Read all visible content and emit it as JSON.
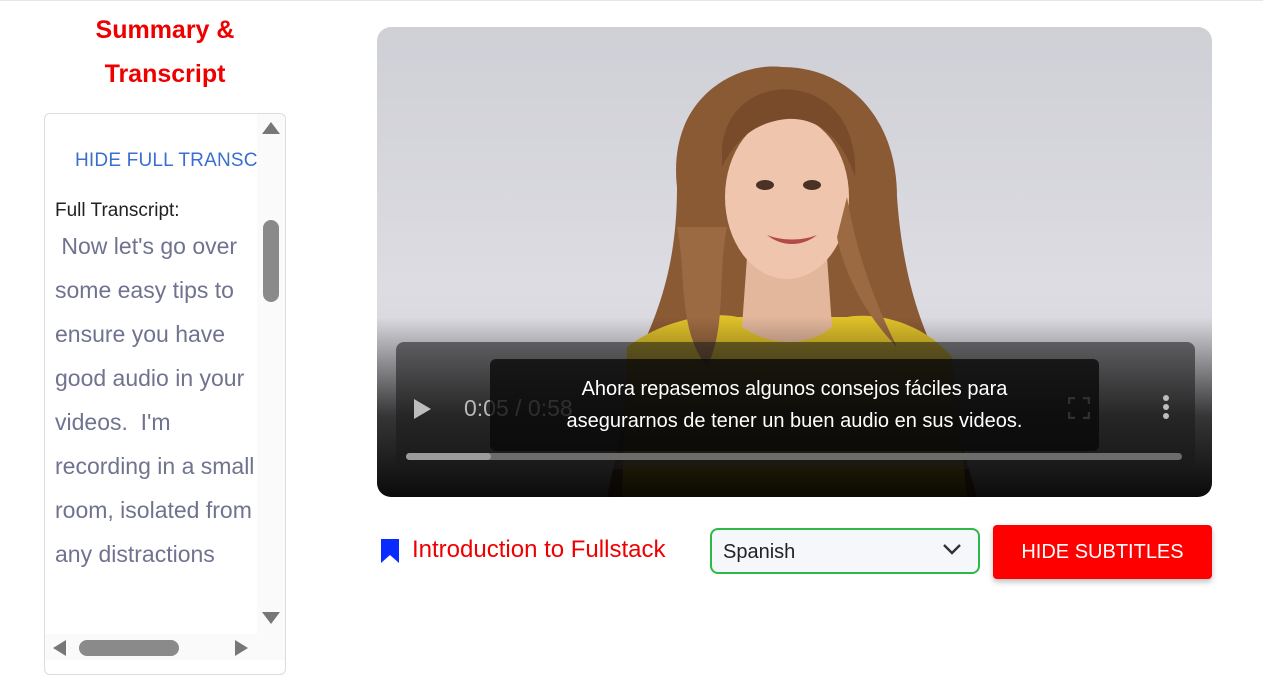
{
  "sidebar": {
    "title_line1": "Summary &",
    "title_line2": "Transcript",
    "hide_button": "HIDE FULL TRANSCRIPT",
    "full_transcript_label": "Full Transcript:",
    "transcript_text": " Now let's go over some easy tips to ensure you have good audio in your videos.  I'm recording in a small room, isolated from any distractions"
  },
  "video": {
    "time": "0:05 / 0:58",
    "progress": 0.11,
    "subtitle_line1": "Ahora repasemos algunos consejos fáciles para",
    "subtitle_line2": "asegurarnos de tener un buen audio en sus videos.",
    "play_icon": "play-icon",
    "fullscreen_icon": "fullscreen-icon",
    "more_icon": "more-vertical-icon"
  },
  "footer": {
    "bookmark_icon": "bookmark-icon",
    "course_title": "Introduction to Fullstack",
    "language": "Spanish",
    "hide_subtitles_label": "HIDE SUBTITLES"
  },
  "colors": {
    "accent_red": "#ee0000",
    "link_blue": "#3a6fcf",
    "select_border": "#2eb84a",
    "bookmark_blue": "#0a2bff"
  }
}
